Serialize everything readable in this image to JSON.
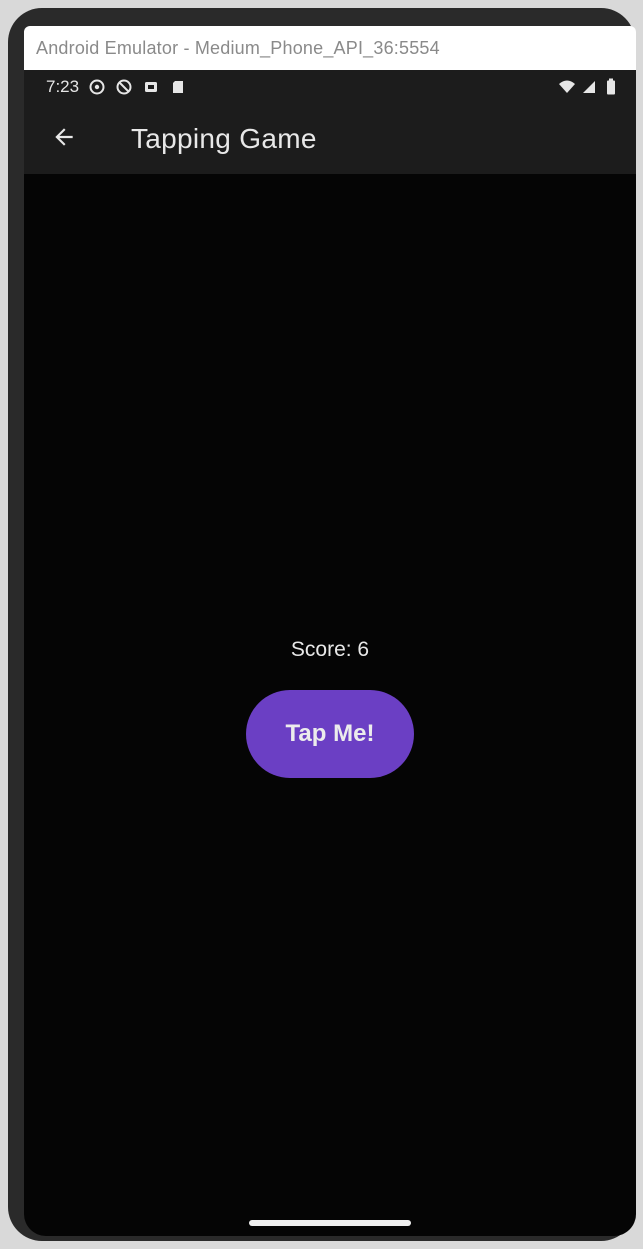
{
  "window": {
    "title": "Android Emulator - Medium_Phone_API_36:5554"
  },
  "status_bar": {
    "time": "7:23",
    "left_icons": [
      "settings-icon",
      "block-icon",
      "notification-icon",
      "sd-card-icon"
    ],
    "right_icons": [
      "wifi-icon",
      "signal-icon",
      "battery-icon"
    ]
  },
  "app_bar": {
    "back_icon": "arrow-back-icon",
    "title": "Tapping Game"
  },
  "game": {
    "score_text": "Score: 6",
    "button_label": "Tap Me!"
  },
  "colors": {
    "background": "#050505",
    "app_bar": "#1c1c1c",
    "button": "#6b3fc4",
    "text": "#e8e8e8"
  }
}
